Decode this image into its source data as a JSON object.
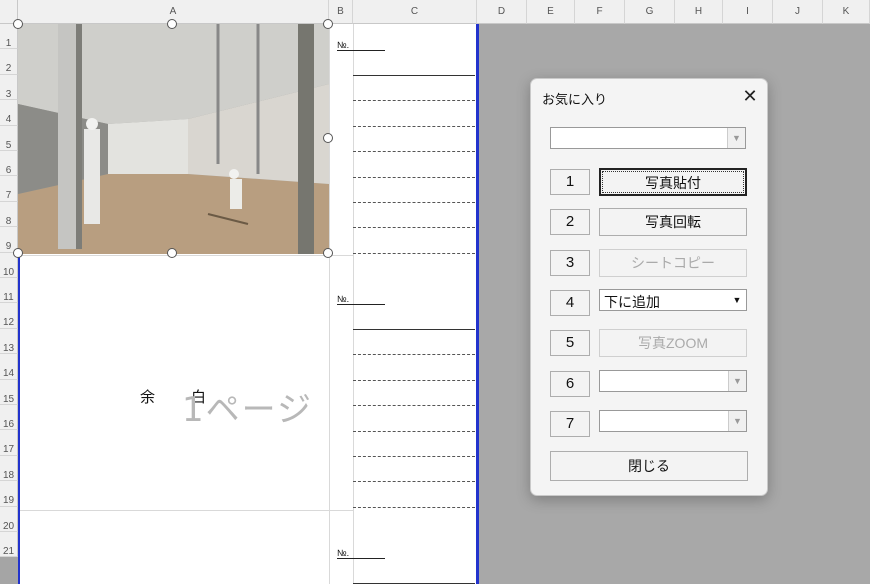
{
  "columns": [
    "A",
    "B",
    "C",
    "D",
    "E",
    "F",
    "G",
    "H",
    "I",
    "J",
    "K"
  ],
  "rows": [
    "1",
    "2",
    "3",
    "4",
    "5",
    "6",
    "7",
    "8",
    "9",
    "10",
    "11",
    "12",
    "13",
    "14",
    "15",
    "16",
    "17",
    "18",
    "19",
    "20",
    "21"
  ],
  "sheet": {
    "no_label": "№.",
    "yohaku": "余白",
    "page_label": "1ページ"
  },
  "dialog": {
    "title": "お気に入り",
    "top_combo_value": "",
    "items": [
      {
        "num": "1",
        "label": "写真貼付",
        "state": "focused",
        "kind": "button"
      },
      {
        "num": "2",
        "label": "写真回転",
        "state": "enabled",
        "kind": "button"
      },
      {
        "num": "3",
        "label": "シートコピー",
        "state": "disabled",
        "kind": "button"
      },
      {
        "num": "4",
        "label": "下に追加",
        "state": "enabled",
        "kind": "combo"
      },
      {
        "num": "5",
        "label": "写真ZOOM",
        "state": "disabled",
        "kind": "button"
      },
      {
        "num": "6",
        "label": "",
        "state": "disabled",
        "kind": "combo"
      },
      {
        "num": "7",
        "label": "",
        "state": "disabled",
        "kind": "combo"
      }
    ],
    "close_label": "閉じる"
  },
  "icons": {
    "close": "close-icon",
    "dropdown": "chevron-down-icon"
  },
  "colors": {
    "print_border": "#2233cc",
    "background": "#a5a5a5"
  }
}
